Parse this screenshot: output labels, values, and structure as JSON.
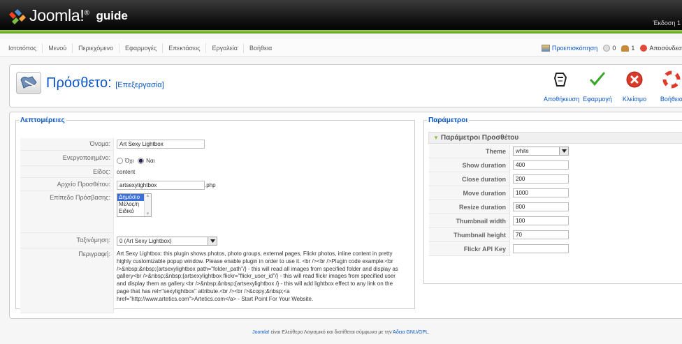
{
  "header": {
    "logo_text": "Joomla!",
    "logo_sup": "®",
    "site_name": "guide",
    "version": "Έκδοση 1"
  },
  "menu": {
    "items": [
      "Ιστοτόπος",
      "Μενού",
      "Περιεχόμενο",
      "Εφαρμογές",
      "Επεκτάσεις",
      "Εργαλεία",
      "Βοήθεια"
    ],
    "preview": "Προεπισκόπηση",
    "messages_count": "0",
    "users_count": "1",
    "logout": "Αποσύνδεσ"
  },
  "toolbar": {
    "title": "Πρόσθετο:",
    "subtitle": "[Επεξεργασία]",
    "buttons": {
      "save": "Αποθήκευση",
      "apply": "Εφαρμογή",
      "close": "Κλείσιμο",
      "help": "Βοήθεια"
    }
  },
  "details": {
    "legend": "Λεπτομέρειες",
    "name_label": "Όνομα:",
    "name_value": "Art Sexy Lightbox",
    "enabled_label": "Ενεργοποιημένο:",
    "enabled_no": "Όχι",
    "enabled_yes": "Ναι",
    "enabled_value": "yes",
    "type_label": "Είδος:",
    "type_value": "content",
    "file_label": "Αρχείο Προσθέτου:",
    "file_value": "artsexylightbox",
    "file_ext": ".php",
    "access_label": "Επίπεδο Πρόσβασης:",
    "access_options": [
      "Δημόσιο",
      "Μέλος/η",
      "Ειδικό"
    ],
    "access_selected": "Δημόσιο",
    "order_label": "Ταξινόμηση:",
    "order_value": "0 (Art Sexy Lightbox)",
    "desc_label": "Περιγραφή:",
    "desc_value": "Art Sexy Lightbox: this plugin shows photos, photo groups, external pages, Flickr photos, inline content in pretty highly customizable popup window. Please enable plugin in order to use it. <br /><br />Plugin code example:<br />&nbsp;&nbsp;{artsexylightbox path=\"folder_path\"/} - this will read all images from specified folder and display as gallery<br />&nbsp;&nbsp;{artsexylightbox flickr=\"flickr_user_id\"/} - this will read flickr images from specified user and display them as gallery.<br />&nbsp;&nbsp;{artsexylightbox /} - this will add lightbox effect to any link on the page that has rel=\"sexylightbox\" attribute.<br /><br />&copy;&nbsp;<a href=\"http://www.artetics.com\">Artetics.com</a> - Start Point For Your Website."
  },
  "params": {
    "legend": "Παράμετροι",
    "pane_title": "Παράμετροι Προσθέτου",
    "rows": [
      {
        "label": "Theme",
        "value": "white",
        "type": "select"
      },
      {
        "label": "Show duration",
        "value": "400",
        "type": "text"
      },
      {
        "label": "Close duration",
        "value": "200",
        "type": "text"
      },
      {
        "label": "Move duration",
        "value": "1000",
        "type": "text"
      },
      {
        "label": "Resize duration",
        "value": "800",
        "type": "text"
      },
      {
        "label": "Thumbnail width",
        "value": "100",
        "type": "text"
      },
      {
        "label": "Thumbnail height",
        "value": "70",
        "type": "text"
      },
      {
        "label": "Flickr API Key",
        "value": "",
        "type": "text"
      }
    ]
  },
  "footer": {
    "brand": "Joomla!",
    "text": " είναι Ελεύθερο Λογισμικό και διατίθεται σύμφωνα με την ",
    "license": "Άδεια GNU/GPL",
    "end": "."
  },
  "colors": {
    "link": "#0b55c4",
    "header_green": "#8bbf45",
    "apply_green": "#3aa52a",
    "close_red": "#d93a2a"
  }
}
